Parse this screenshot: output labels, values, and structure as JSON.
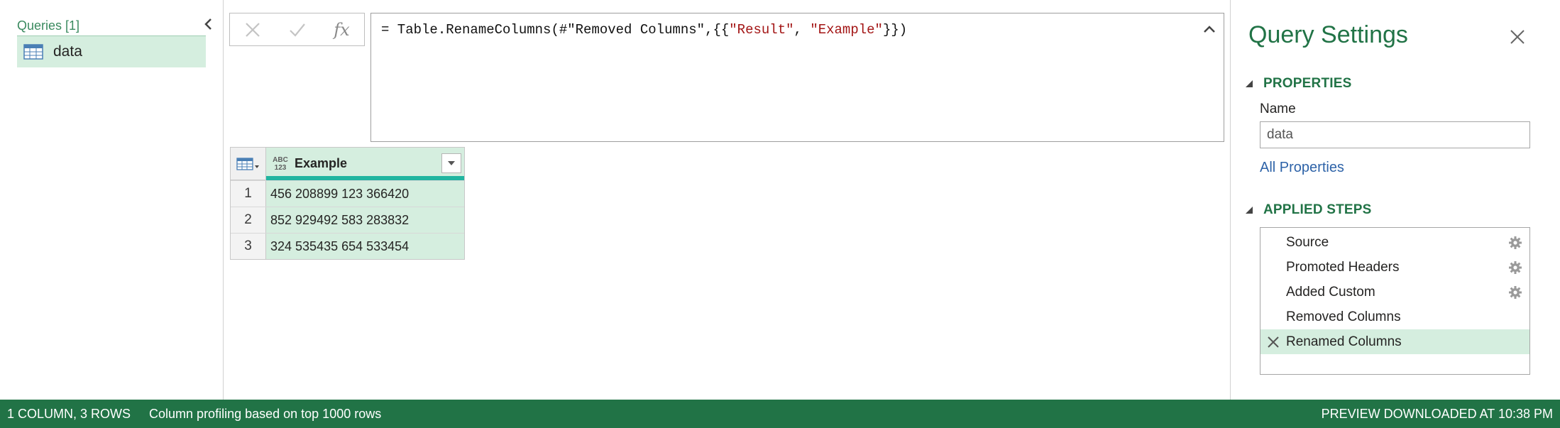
{
  "queries": {
    "header": "Queries [1]",
    "items": [
      {
        "name": "data",
        "icon": "table-icon",
        "selected": true
      }
    ]
  },
  "formula_bar": {
    "fx": "fx",
    "prefix": "= Table.RenameColumns(#\"Removed Columns\",{{",
    "str1": "\"Result\"",
    "sep": ", ",
    "str2": "\"Example\"",
    "suffix": "}})"
  },
  "grid": {
    "column": {
      "name": "Example",
      "type_icon_top": "ABC",
      "type_icon_bottom": "123"
    },
    "rows": [
      {
        "num": "1",
        "value": "456 208899 123 366420"
      },
      {
        "num": "2",
        "value": "852 929492 583 283832"
      },
      {
        "num": "3",
        "value": "324 535435 654 533454"
      }
    ]
  },
  "settings": {
    "title": "Query Settings",
    "properties_header": "PROPERTIES",
    "name_label": "Name",
    "name_value": "data",
    "all_properties": "All Properties",
    "steps_header": "APPLIED STEPS",
    "steps": [
      {
        "label": "Source",
        "has_gear": true
      },
      {
        "label": "Promoted Headers",
        "has_gear": true
      },
      {
        "label": "Added Custom",
        "has_gear": true
      },
      {
        "label": "Removed Columns",
        "has_gear": false
      },
      {
        "label": "Renamed Columns",
        "has_gear": false,
        "selected": true
      }
    ]
  },
  "status": {
    "left": "1 COLUMN, 3 ROWS",
    "mid": "Column profiling based on top 1000 rows",
    "right": "PREVIEW DOWNLOADED AT 10:38 PM"
  },
  "colors": {
    "accent": "#217346",
    "selection": "#d5eedf",
    "column_bar": "#21b5a0",
    "link": "#2e63a8",
    "string_literal": "#a31515"
  }
}
